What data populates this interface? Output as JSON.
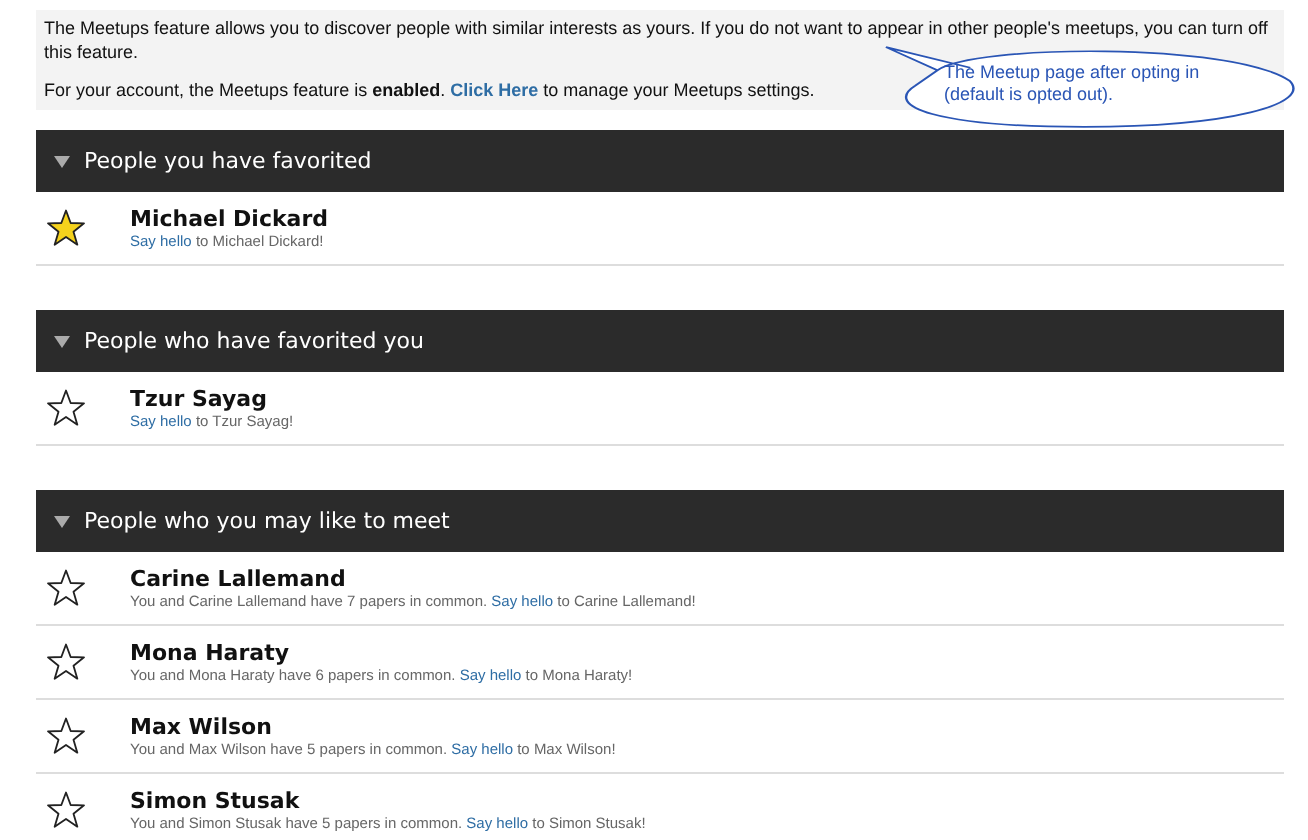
{
  "intro": {
    "paragraph": "The Meetups feature allows you to discover people with similar interests as yours. If you do not want to appear in other people's meetups, you can turn off this feature.",
    "account_before": "For your account, the Meetups feature is **enabled**.",
    "account_link": "Click Here",
    "account_after": "to manage your Meetups settings."
  },
  "callout": {
    "text": "The Meetup page after opting in (default is opted out)."
  },
  "sections": [
    {
      "title": "People you have favorited",
      "expanded": true,
      "people": [
        {
          "name": "Michael Dickard",
          "favorited": true,
          "link": "Say hello",
          "after": "to Michael Dickard!"
        }
      ]
    },
    {
      "title": "People who have favorited you",
      "expanded": true,
      "people": [
        {
          "name": "Tzur Sayag",
          "favorited": false,
          "link": "Say hello",
          "after": "to Tzur Sayag!"
        }
      ]
    },
    {
      "title": "People who you may like to meet",
      "expanded": true,
      "people": [
        {
          "name": "Carine Lallemand",
          "favorited": false,
          "before": "You and Carine Lallemand have 7 papers in common.",
          "link": "Say hello",
          "after": "to Carine Lallemand!"
        },
        {
          "name": "Mona Haraty",
          "favorited": false,
          "before": "You and Mona Haraty have 6 papers in common.",
          "link": "Say hello",
          "after": "to Mona Haraty!"
        },
        {
          "name": "Max Wilson",
          "favorited": false,
          "before": "You and Max Wilson have 5 papers in common.",
          "link": "Say hello",
          "after": "to Max Wilson!"
        },
        {
          "name": "Simon Stusak",
          "favorited": false,
          "before": "You and Simon Stusak have 5 papers in common.",
          "link": "Say hello",
          "after": "to Simon Stusak!"
        }
      ]
    }
  ]
}
